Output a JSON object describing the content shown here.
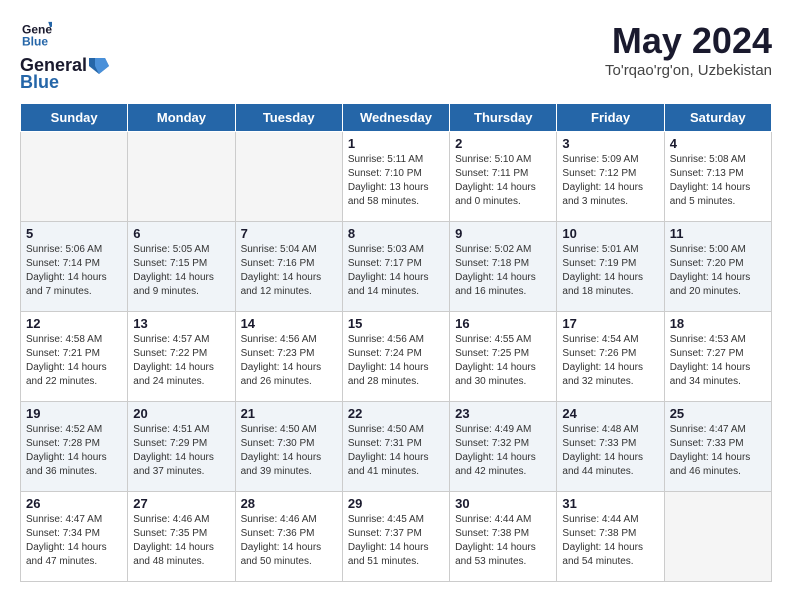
{
  "header": {
    "logo_line1": "General",
    "logo_line2": "Blue",
    "month_title": "May 2024",
    "location": "To'rqao'rg'on, Uzbekistan"
  },
  "days_of_week": [
    "Sunday",
    "Monday",
    "Tuesday",
    "Wednesday",
    "Thursday",
    "Friday",
    "Saturday"
  ],
  "weeks": [
    [
      {
        "num": "",
        "sunrise": "",
        "sunset": "",
        "daylight": ""
      },
      {
        "num": "",
        "sunrise": "",
        "sunset": "",
        "daylight": ""
      },
      {
        "num": "",
        "sunrise": "",
        "sunset": "",
        "daylight": ""
      },
      {
        "num": "1",
        "sunrise": "Sunrise: 5:11 AM",
        "sunset": "Sunset: 7:10 PM",
        "daylight": "Daylight: 13 hours and 58 minutes."
      },
      {
        "num": "2",
        "sunrise": "Sunrise: 5:10 AM",
        "sunset": "Sunset: 7:11 PM",
        "daylight": "Daylight: 14 hours and 0 minutes."
      },
      {
        "num": "3",
        "sunrise": "Sunrise: 5:09 AM",
        "sunset": "Sunset: 7:12 PM",
        "daylight": "Daylight: 14 hours and 3 minutes."
      },
      {
        "num": "4",
        "sunrise": "Sunrise: 5:08 AM",
        "sunset": "Sunset: 7:13 PM",
        "daylight": "Daylight: 14 hours and 5 minutes."
      }
    ],
    [
      {
        "num": "5",
        "sunrise": "Sunrise: 5:06 AM",
        "sunset": "Sunset: 7:14 PM",
        "daylight": "Daylight: 14 hours and 7 minutes."
      },
      {
        "num": "6",
        "sunrise": "Sunrise: 5:05 AM",
        "sunset": "Sunset: 7:15 PM",
        "daylight": "Daylight: 14 hours and 9 minutes."
      },
      {
        "num": "7",
        "sunrise": "Sunrise: 5:04 AM",
        "sunset": "Sunset: 7:16 PM",
        "daylight": "Daylight: 14 hours and 12 minutes."
      },
      {
        "num": "8",
        "sunrise": "Sunrise: 5:03 AM",
        "sunset": "Sunset: 7:17 PM",
        "daylight": "Daylight: 14 hours and 14 minutes."
      },
      {
        "num": "9",
        "sunrise": "Sunrise: 5:02 AM",
        "sunset": "Sunset: 7:18 PM",
        "daylight": "Daylight: 14 hours and 16 minutes."
      },
      {
        "num": "10",
        "sunrise": "Sunrise: 5:01 AM",
        "sunset": "Sunset: 7:19 PM",
        "daylight": "Daylight: 14 hours and 18 minutes."
      },
      {
        "num": "11",
        "sunrise": "Sunrise: 5:00 AM",
        "sunset": "Sunset: 7:20 PM",
        "daylight": "Daylight: 14 hours and 20 minutes."
      }
    ],
    [
      {
        "num": "12",
        "sunrise": "Sunrise: 4:58 AM",
        "sunset": "Sunset: 7:21 PM",
        "daylight": "Daylight: 14 hours and 22 minutes."
      },
      {
        "num": "13",
        "sunrise": "Sunrise: 4:57 AM",
        "sunset": "Sunset: 7:22 PM",
        "daylight": "Daylight: 14 hours and 24 minutes."
      },
      {
        "num": "14",
        "sunrise": "Sunrise: 4:56 AM",
        "sunset": "Sunset: 7:23 PM",
        "daylight": "Daylight: 14 hours and 26 minutes."
      },
      {
        "num": "15",
        "sunrise": "Sunrise: 4:56 AM",
        "sunset": "Sunset: 7:24 PM",
        "daylight": "Daylight: 14 hours and 28 minutes."
      },
      {
        "num": "16",
        "sunrise": "Sunrise: 4:55 AM",
        "sunset": "Sunset: 7:25 PM",
        "daylight": "Daylight: 14 hours and 30 minutes."
      },
      {
        "num": "17",
        "sunrise": "Sunrise: 4:54 AM",
        "sunset": "Sunset: 7:26 PM",
        "daylight": "Daylight: 14 hours and 32 minutes."
      },
      {
        "num": "18",
        "sunrise": "Sunrise: 4:53 AM",
        "sunset": "Sunset: 7:27 PM",
        "daylight": "Daylight: 14 hours and 34 minutes."
      }
    ],
    [
      {
        "num": "19",
        "sunrise": "Sunrise: 4:52 AM",
        "sunset": "Sunset: 7:28 PM",
        "daylight": "Daylight: 14 hours and 36 minutes."
      },
      {
        "num": "20",
        "sunrise": "Sunrise: 4:51 AM",
        "sunset": "Sunset: 7:29 PM",
        "daylight": "Daylight: 14 hours and 37 minutes."
      },
      {
        "num": "21",
        "sunrise": "Sunrise: 4:50 AM",
        "sunset": "Sunset: 7:30 PM",
        "daylight": "Daylight: 14 hours and 39 minutes."
      },
      {
        "num": "22",
        "sunrise": "Sunrise: 4:50 AM",
        "sunset": "Sunset: 7:31 PM",
        "daylight": "Daylight: 14 hours and 41 minutes."
      },
      {
        "num": "23",
        "sunrise": "Sunrise: 4:49 AM",
        "sunset": "Sunset: 7:32 PM",
        "daylight": "Daylight: 14 hours and 42 minutes."
      },
      {
        "num": "24",
        "sunrise": "Sunrise: 4:48 AM",
        "sunset": "Sunset: 7:33 PM",
        "daylight": "Daylight: 14 hours and 44 minutes."
      },
      {
        "num": "25",
        "sunrise": "Sunrise: 4:47 AM",
        "sunset": "Sunset: 7:33 PM",
        "daylight": "Daylight: 14 hours and 46 minutes."
      }
    ],
    [
      {
        "num": "26",
        "sunrise": "Sunrise: 4:47 AM",
        "sunset": "Sunset: 7:34 PM",
        "daylight": "Daylight: 14 hours and 47 minutes."
      },
      {
        "num": "27",
        "sunrise": "Sunrise: 4:46 AM",
        "sunset": "Sunset: 7:35 PM",
        "daylight": "Daylight: 14 hours and 48 minutes."
      },
      {
        "num": "28",
        "sunrise": "Sunrise: 4:46 AM",
        "sunset": "Sunset: 7:36 PM",
        "daylight": "Daylight: 14 hours and 50 minutes."
      },
      {
        "num": "29",
        "sunrise": "Sunrise: 4:45 AM",
        "sunset": "Sunset: 7:37 PM",
        "daylight": "Daylight: 14 hours and 51 minutes."
      },
      {
        "num": "30",
        "sunrise": "Sunrise: 4:44 AM",
        "sunset": "Sunset: 7:38 PM",
        "daylight": "Daylight: 14 hours and 53 minutes."
      },
      {
        "num": "31",
        "sunrise": "Sunrise: 4:44 AM",
        "sunset": "Sunset: 7:38 PM",
        "daylight": "Daylight: 14 hours and 54 minutes."
      },
      {
        "num": "",
        "sunrise": "",
        "sunset": "",
        "daylight": ""
      }
    ]
  ]
}
